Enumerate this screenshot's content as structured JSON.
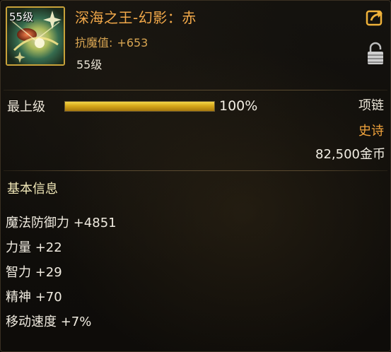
{
  "item": {
    "icon_name": "epic-necklace-icon",
    "icon_level": "55级",
    "name": "深海之王-幻影：赤",
    "attribute": {
      "label": "抗魔值:",
      "value": "+653"
    },
    "level_requirement": "55级"
  },
  "enhancement": {
    "label": "最上级",
    "percent_text": "100%",
    "fill_fraction": 1.0
  },
  "slot_type": "项链",
  "rarity": "史诗",
  "price": "82,500金币",
  "basic_info": {
    "title": "基本信息",
    "stats": [
      "魔法防御力 +4851",
      "力量 +22",
      "智力 +29",
      "精神 +70",
      "移动速度 +7%"
    ]
  },
  "colors": {
    "item_name": "#f2a94a",
    "rarity_epic": "#f0a33c",
    "frame_gold": "#c9a23a",
    "bar_gold": "#d6a71a"
  },
  "controls": {
    "share_icon": "share-icon",
    "lock_icon": "lock-icon"
  }
}
